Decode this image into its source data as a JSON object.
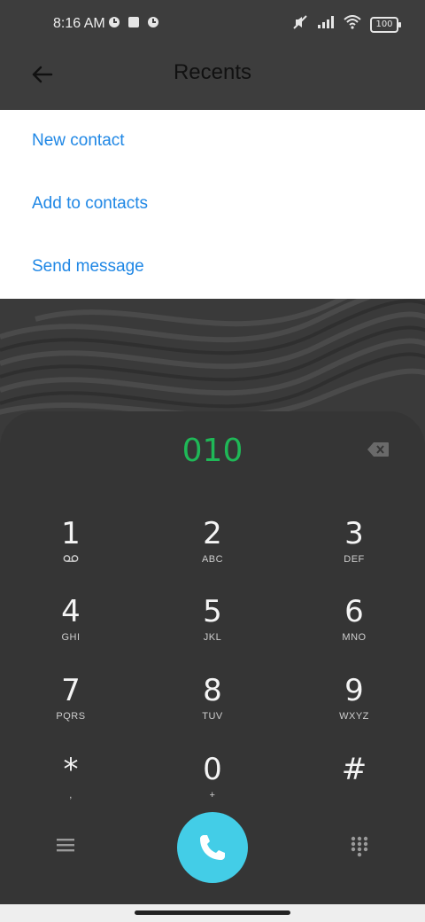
{
  "status_bar": {
    "time": "8:16 AM",
    "battery": "100",
    "icons": [
      "app-notification-icon",
      "square-notification-icon",
      "app-notification-icon",
      "mute-icon",
      "signal-icon",
      "wifi-icon",
      "battery-icon"
    ]
  },
  "header": {
    "title": "Recents"
  },
  "menu": {
    "items": [
      {
        "label": "New contact"
      },
      {
        "label": "Add to contacts"
      },
      {
        "label": "Send message"
      }
    ]
  },
  "dialer": {
    "number": "010",
    "keys": [
      {
        "digit": "1",
        "sub": ""
      },
      {
        "digit": "2",
        "sub": "ABC"
      },
      {
        "digit": "3",
        "sub": "DEF"
      },
      {
        "digit": "4",
        "sub": "GHI"
      },
      {
        "digit": "5",
        "sub": "JKL"
      },
      {
        "digit": "6",
        "sub": "MNO"
      },
      {
        "digit": "7",
        "sub": "PQRS"
      },
      {
        "digit": "8",
        "sub": "TUV"
      },
      {
        "digit": "9",
        "sub": "WXYZ"
      },
      {
        "digit": "*",
        "sub": ","
      },
      {
        "digit": "0",
        "sub": "+"
      },
      {
        "digit": "#",
        "sub": ""
      }
    ]
  },
  "colors": {
    "accent_blue": "#1f87e5",
    "number_green": "#1fb857",
    "call_cyan": "#43cde7"
  }
}
